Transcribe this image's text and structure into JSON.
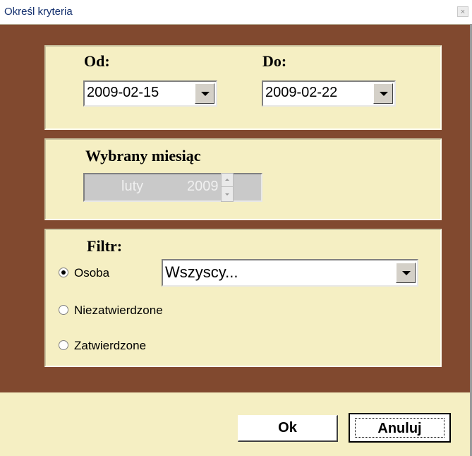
{
  "window": {
    "title": "Określ kryteria",
    "close_label": "×"
  },
  "dates": {
    "from_label": "Od:",
    "from_value": "2009-02-15",
    "to_label": "Do:",
    "to_value": "2009-02-22"
  },
  "month": {
    "label": "Wybrany miesiąc",
    "month_value": "luty",
    "year_value": "2009",
    "enabled": false
  },
  "filter": {
    "label": "Filtr:",
    "options": [
      {
        "label": "Osoba",
        "checked": true
      },
      {
        "label": "Niezatwierdzone",
        "checked": false
      },
      {
        "label": "Zatwierdzone",
        "checked": false
      }
    ],
    "person_value": "Wszyscy..."
  },
  "buttons": {
    "ok": "Ok",
    "cancel": "Anuluj"
  },
  "colors": {
    "frame": "#81492f",
    "panel": "#f5efc3",
    "title_text": "#14306e"
  }
}
